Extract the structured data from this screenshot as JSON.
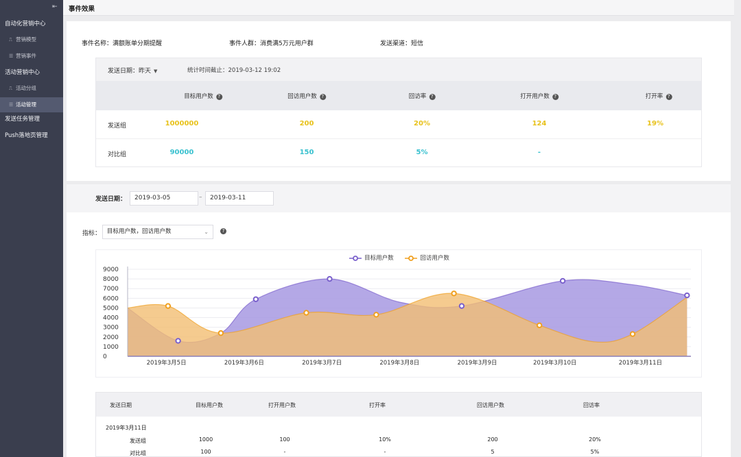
{
  "sidebar": {
    "collapse_icon": "⇤",
    "groups": [
      {
        "label": "自动化营销中心",
        "items": [
          {
            "icon": "trend-icon",
            "glyph": "⎍",
            "label": "营销模型"
          },
          {
            "icon": "sort-icon",
            "glyph": "☰",
            "label": "营销事件"
          }
        ]
      },
      {
        "label": "活动营销中心",
        "items": [
          {
            "icon": "trend-icon",
            "glyph": "⎍",
            "label": "活动分组"
          },
          {
            "icon": "sort-icon",
            "glyph": "☰",
            "label": "活动管理",
            "active": true
          }
        ]
      },
      {
        "label": "发送任务管理",
        "items": []
      },
      {
        "label": "Push落地页管理",
        "items": []
      }
    ]
  },
  "header": {
    "title": "事件效果"
  },
  "event_info": {
    "name": "事件名称：满额账单分期提醒",
    "audience": "事件人群：消费满5万元用户群",
    "channel": "发送渠道：短信"
  },
  "stats": {
    "date_label": "发送日期：昨天",
    "date_caret": "▼",
    "time_label": "统计时间截止：2019-03-12  19:02",
    "help_glyph": "?",
    "columns": [
      "目标用户数",
      "回访用户数",
      "回访率",
      "打开用户数",
      "打开率"
    ],
    "rows": [
      {
        "label": "发送组",
        "values": [
          "1000000",
          "200",
          "20%",
          "124",
          "19%"
        ],
        "color": "yellow"
      },
      {
        "label": "对比组",
        "values": [
          "90000",
          "150",
          "5%",
          "-",
          ""
        ],
        "color": "teal"
      }
    ]
  },
  "filter": {
    "label": "发送日期：",
    "start": "2019-03-05",
    "separator": "–",
    "end": "2019-03-11",
    "metric_label": "指标：",
    "metric_value": "目标用户数，回访用户数",
    "metric_arrow": "⌄"
  },
  "chart_data": {
    "type": "area",
    "title": "",
    "xlabel": "",
    "ylabel": "",
    "ylim": [
      0,
      9000
    ],
    "yticks": [
      "9000",
      "8000",
      "7000",
      "6000",
      "5000",
      "4000",
      "3000",
      "2000",
      "1000",
      "0"
    ],
    "xlim": [
      0,
      7.25
    ],
    "xticks": [
      {
        "x": 0.5,
        "label": "2019年3月5日"
      },
      {
        "x": 1.5,
        "label": "2019年3月6日"
      },
      {
        "x": 2.5,
        "label": "2019年3月7日"
      },
      {
        "x": 3.5,
        "label": "2019年3月8日"
      },
      {
        "x": 4.5,
        "label": "2019年3月9日"
      },
      {
        "x": 5.5,
        "label": "2019年3月10日"
      },
      {
        "x": 6.6,
        "label": "2019年3月11日"
      }
    ],
    "legend_position": "top",
    "grid": true,
    "series": [
      {
        "name": "目标用户数",
        "color": "#7a60cc",
        "fill": "#a799e2",
        "points": [
          {
            "x": 0,
            "y": 5000,
            "marker": false
          },
          {
            "x": 0.65,
            "y": 1600,
            "marker": true
          },
          {
            "x": 1.2,
            "y": 2400,
            "marker": false
          },
          {
            "x": 1.65,
            "y": 5900,
            "marker": true
          },
          {
            "x": 2.6,
            "y": 8000,
            "marker": true
          },
          {
            "x": 3.5,
            "y": 5600,
            "marker": false
          },
          {
            "x": 4.3,
            "y": 5200,
            "marker": true
          },
          {
            "x": 5.6,
            "y": 7800,
            "marker": true
          },
          {
            "x": 6.5,
            "y": 7400,
            "marker": false
          },
          {
            "x": 7.2,
            "y": 6300,
            "marker": true
          }
        ]
      },
      {
        "name": "回访用户数",
        "color": "#f0a020",
        "fill": "#f2be73",
        "points": [
          {
            "x": 0,
            "y": 5000,
            "marker": false
          },
          {
            "x": 0.52,
            "y": 5200,
            "marker": true
          },
          {
            "x": 1.2,
            "y": 2400,
            "marker": true
          },
          {
            "x": 2.3,
            "y": 4500,
            "marker": true
          },
          {
            "x": 3.2,
            "y": 4300,
            "marker": true
          },
          {
            "x": 4.2,
            "y": 6500,
            "marker": true
          },
          {
            "x": 5.3,
            "y": 3200,
            "marker": true
          },
          {
            "x": 6.0,
            "y": 1500,
            "marker": false
          },
          {
            "x": 6.5,
            "y": 2300,
            "marker": true
          },
          {
            "x": 7.2,
            "y": 6100,
            "marker": false
          }
        ]
      }
    ]
  },
  "table": {
    "headers": [
      "发送日期",
      "目标用户数",
      "打开用户数",
      "打开率",
      "回访用户数",
      "回访率"
    ],
    "date": "2019年3月11日",
    "rows": [
      {
        "label": "发送组",
        "values": [
          "1000",
          "100",
          "10%",
          "200",
          "20%"
        ]
      },
      {
        "label": "对比组",
        "values": [
          "100",
          "-",
          "-",
          "5",
          "5%"
        ]
      }
    ]
  }
}
